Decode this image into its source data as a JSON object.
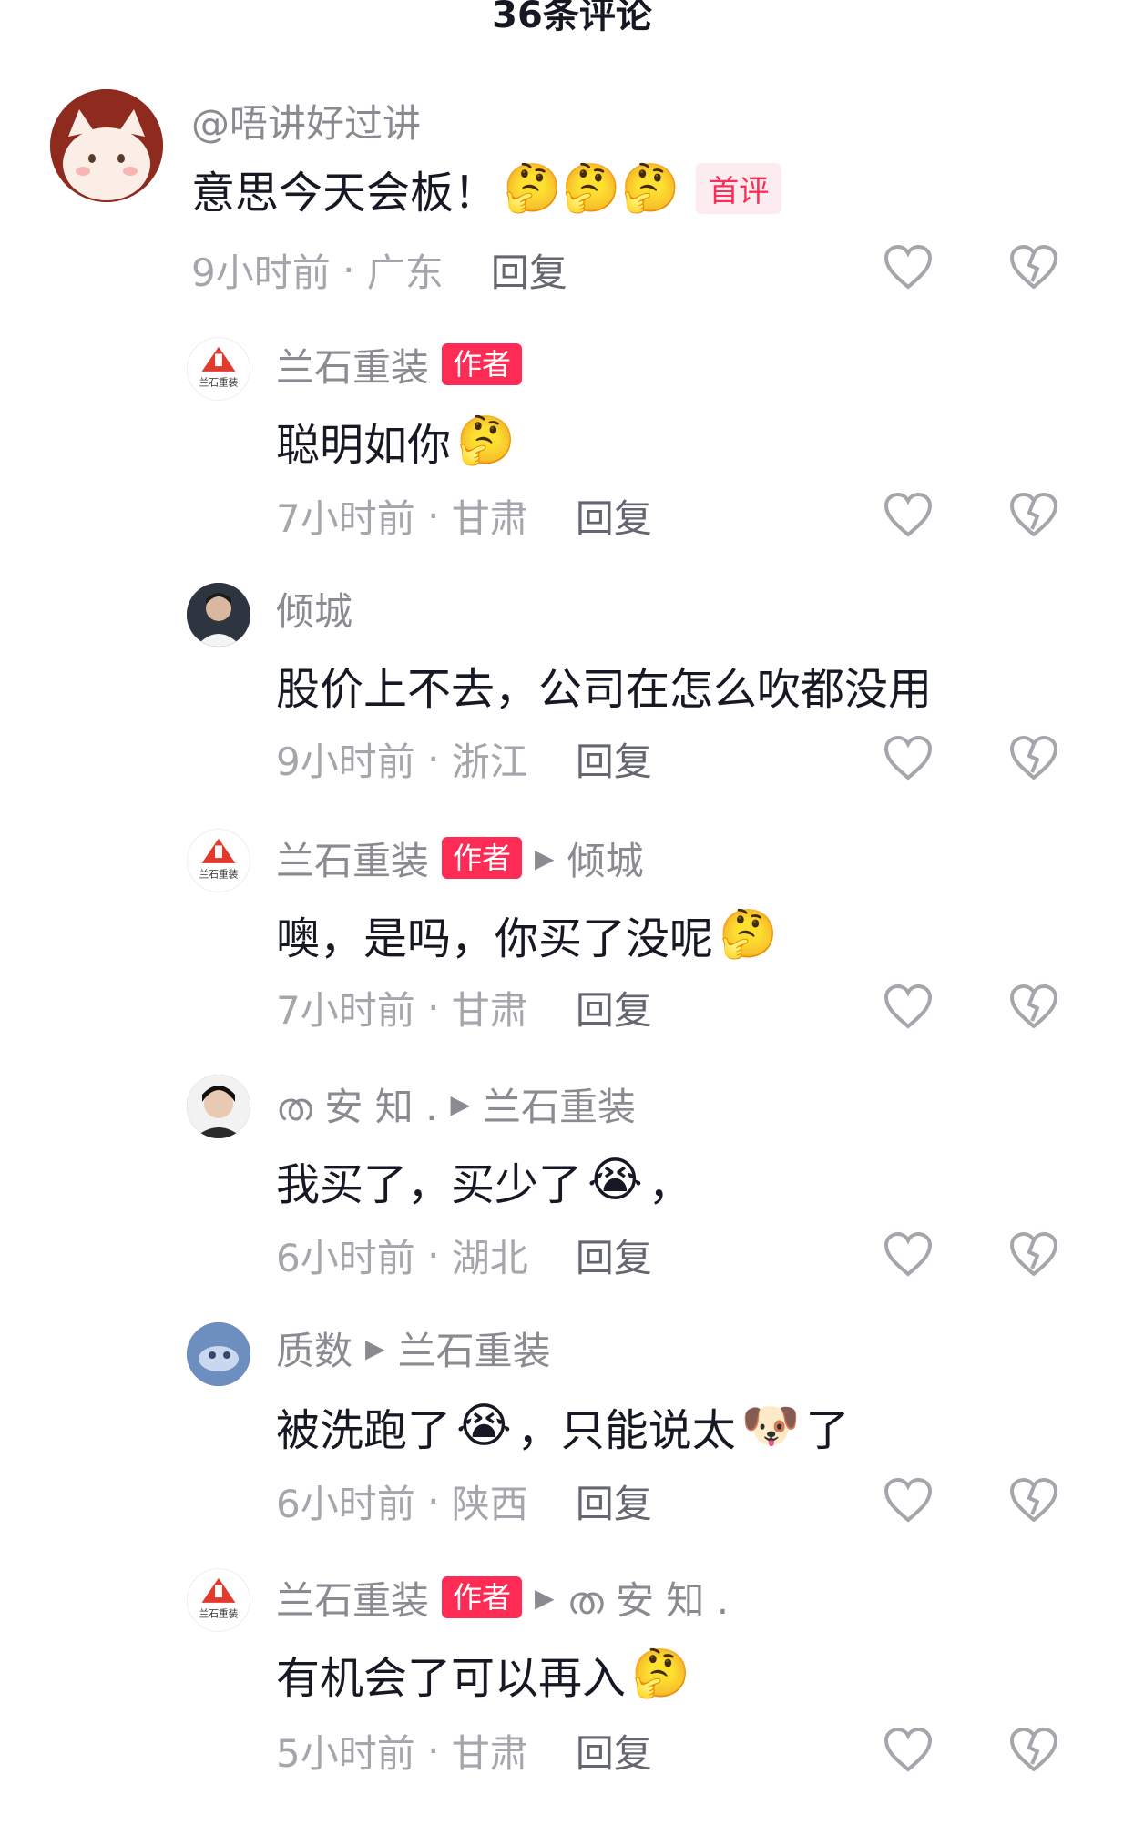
{
  "header": {
    "title": "36条评论"
  },
  "comments": [
    {
      "user": "@唔讲好过讲",
      "text": "意思今天会板！",
      "emojis": "🤔🤔🤔",
      "first_tag": "首评",
      "time": "9小时前",
      "location": "广东",
      "reply_label": "回复",
      "avatar": "cat-avatar"
    },
    {
      "user": "兰石重装",
      "author_tag": "作者",
      "text": "聪明如你",
      "emojis": "🤔",
      "time": "7小时前",
      "location": "甘肃",
      "reply_label": "回复",
      "avatar": "brand-logo"
    },
    {
      "user": "倾城",
      "text": "股价上不去，公司在怎么吹都没用",
      "time": "9小时前",
      "location": "浙江",
      "reply_label": "回复",
      "avatar": "photo-avatar"
    },
    {
      "user": "兰石重装",
      "author_tag": "作者",
      "reply_to": "倾城",
      "text": "噢，是吗，你买了没呢",
      "emojis": "🤔",
      "time": "7小时前",
      "location": "甘肃",
      "reply_label": "回复",
      "avatar": "brand-logo"
    },
    {
      "user": "ത 安 知 .",
      "reply_to": "兰石重装",
      "text": "我买了，买少了",
      "emojis": "😭",
      "text_after": "，",
      "time": "6小时前",
      "location": "湖北",
      "reply_label": "回复",
      "avatar": "photo-avatar"
    },
    {
      "user": "质数",
      "reply_to": "兰石重装",
      "text": "被洗跑了",
      "emojis": "😭",
      "text_after": "，只能说太",
      "emoji_2": "🐶",
      "text_after_2": "了",
      "time": "6小时前",
      "location": "陕西",
      "reply_label": "回复",
      "avatar": "photo-avatar"
    },
    {
      "user": "兰石重装",
      "author_tag": "作者",
      "reply_to": "ത 安 知 .",
      "text": "有机会了可以再入",
      "emojis": "🤔",
      "time": "5小时前",
      "location": "甘肃",
      "reply_label": "回复",
      "avatar": "brand-logo"
    }
  ],
  "brand_logo_text": "兰石重装",
  "colors": {
    "accent": "#fe2c55",
    "muted": "#8a8b91",
    "text": "#161823"
  },
  "icons": {
    "like": "heart-outline-icon",
    "dislike": "broken-heart-outline-icon",
    "reply_arrow": "triangle-right-icon"
  }
}
